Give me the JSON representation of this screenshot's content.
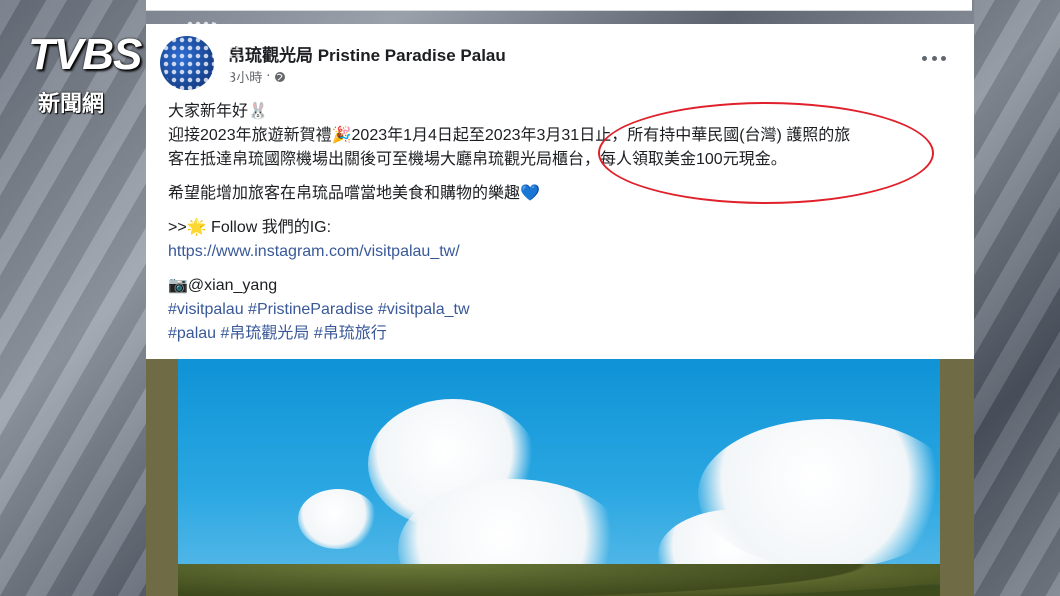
{
  "page": {
    "name": "帛琉觀光局 Pristine Paradise Palau",
    "time": "3小時",
    "audience_icon": "globe-icon",
    "more_icon": "more-options-icon"
  },
  "post": {
    "greeting": "大家新年好🐰",
    "line1": "迎接2023年旅遊新賀禮🎉2023年1月4日起至2023年3月31日止，所有持中華民國(台灣) 護照的旅",
    "line2": "客在抵達帛琉國際機場出關後可至機場大廳帛琉觀光局櫃台，每人領取美金100元現金。",
    "line3": "希望能增加旅客在帛琉品嚐當地美食和購物的樂趣💙",
    "follow": ">>🌟  Follow 我們的IG:",
    "ig_link": "https://www.instagram.com/visitpalau_tw/",
    "photo_credit": "📷@xian_yang",
    "hashtags1": "#visitpalau #PristineParadise #visitpala_tw",
    "hashtags2": "#palau #帛琉觀光局 #帛琉旅行"
  },
  "watermark": {
    "brand": "TVBS",
    "sub": "新聞網"
  },
  "colors": {
    "link": "#385898",
    "highlight_oval": "#e0202a"
  }
}
